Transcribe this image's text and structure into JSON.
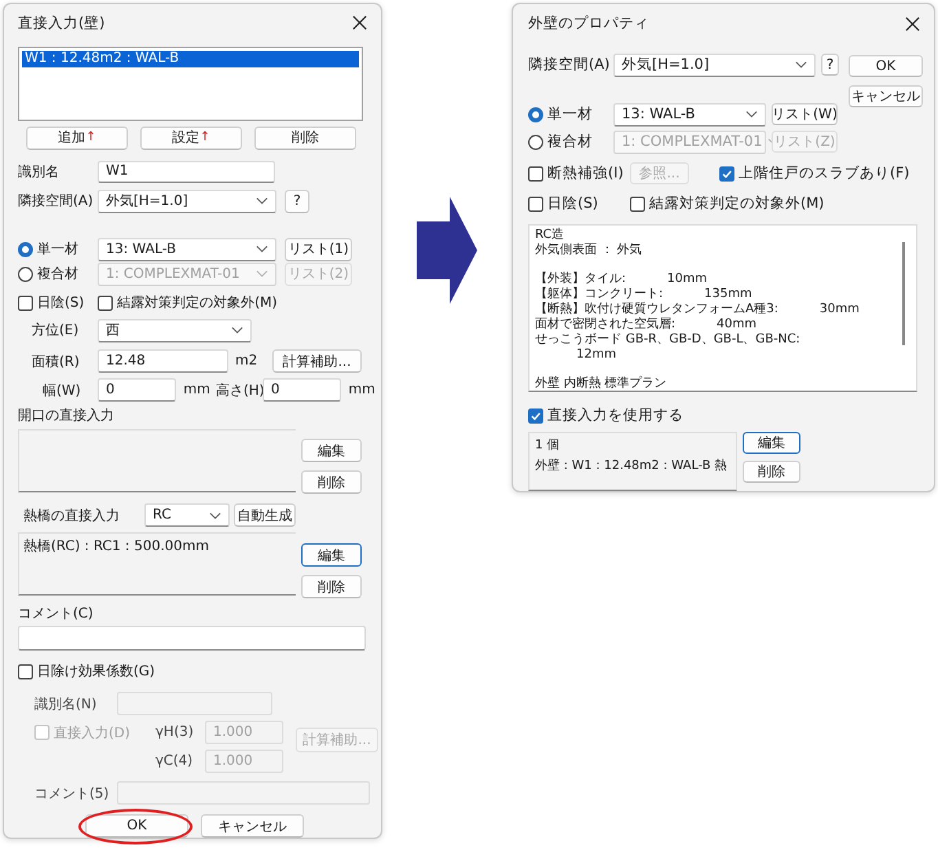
{
  "left_dialog": {
    "title": "直接入力(壁)",
    "entries": [
      {
        "text": "W1 : 12.48m2 : WAL-B",
        "selected": true
      }
    ],
    "entry_buttons": [
      {
        "label": "追加",
        "arrow": "↑"
      },
      {
        "label": "設定",
        "arrow": "↑"
      },
      {
        "label": "削除"
      }
    ],
    "name": {
      "label": "識別名",
      "value": "W1"
    },
    "adjacent": {
      "label": "隣接空間(A)",
      "value": "外気[H=1.0]",
      "help": "?"
    },
    "materials": [
      {
        "label": "単一材",
        "selected": true,
        "value": "13: WAL-B",
        "list_button": "リスト(1)",
        "disabled": false
      },
      {
        "label": "複合材",
        "selected": false,
        "value": "1: COMPLEXMAT-01",
        "list_button": "リスト(2)",
        "disabled": true
      }
    ],
    "checks": [
      {
        "label": "日陰(S)",
        "checked": false
      },
      {
        "label": "結露対策判定の対象外(M)",
        "checked": false
      }
    ],
    "direction": {
      "label": "方位(E)",
      "value": "西"
    },
    "area": {
      "label": "面積(R)",
      "value": "12.48",
      "unit": "m2",
      "button": "計算補助..."
    },
    "width": {
      "label": "幅(W)",
      "value": "0",
      "unit": "mm"
    },
    "height": {
      "label": "高さ(H)",
      "value": "0",
      "unit": "mm"
    },
    "openings": {
      "title": "開口の直接入力",
      "buttons": [
        "編集",
        "削除"
      ]
    },
    "thermal_bridge": {
      "label": "熱橋の直接入力",
      "type": "RC",
      "auto_button": "自動生成",
      "items": [
        "熱橋(RC) : RC1 : 500.00mm"
      ],
      "buttons": [
        {
          "label": "編集",
          "focused": true
        },
        {
          "label": "削除",
          "focused": false
        }
      ]
    },
    "comment": {
      "label": "コメント(C)"
    },
    "shading": {
      "label": "日除け効果係数(G)",
      "checked": false,
      "disabled": true,
      "name_label": "識別名(N)",
      "direct": {
        "label": "直接入力(D)",
        "checked": false
      },
      "gamma_h": {
        "label": "γH(3)",
        "value": "1.000"
      },
      "gamma_c": {
        "label": "γC(4)",
        "value": "1.000"
      },
      "calc_button": "計算補助...",
      "comment_label": "コメント(5)"
    },
    "ok": {
      "label": "OK",
      "circled": true
    },
    "cancel": "キャンセル"
  },
  "right_dialog": {
    "title": "外壁のプロパティ",
    "adjacent": {
      "label": "隣接空間(A)",
      "value": "外気[H=1.0]",
      "help": "?"
    },
    "ok": "OK",
    "cancel": "キャンセル",
    "materials": [
      {
        "label": "単一材",
        "selected": true,
        "value": "13: WAL-B",
        "list_button": "リスト(W)",
        "disabled": false
      },
      {
        "label": "複合材",
        "selected": false,
        "value": "1: COMPLEXMAT-01",
        "list_button": "リスト(Z)",
        "disabled": true
      }
    ],
    "insulation": {
      "label": "断熱補強(I)",
      "checked": false,
      "button": "参照...",
      "button_disabled": true
    },
    "upper_slab": {
      "label": "上階住戸のスラブあり(F)",
      "checked": true
    },
    "checks": [
      {
        "label": "日陰(S)",
        "checked": false
      },
      {
        "label": "結露対策判定の対象外(M)",
        "checked": false
      }
    ],
    "spec_paragraphs": [
      {
        "lines": [
          {
            "text": "RC造"
          },
          {
            "text": "外気側表面 ： 外気"
          }
        ]
      },
      {
        "lines": [
          {
            "text": "【外装】タイル:",
            "value": "10mm"
          },
          {
            "text": "【躯体】コンクリート:",
            "value": "135mm"
          },
          {
            "text": "【断熱】吹付け硬質ウレタンフォームA種3:",
            "value": "30mm"
          },
          {
            "text": "面材で密閉された空気層:",
            "value": "40mm"
          },
          {
            "text": "せっこうボード GB-R、GB-D、GB-L、GB-NC:",
            "value": "12mm"
          }
        ]
      },
      {
        "lines": [
          {
            "text": "外壁 内断熱 標準プラン"
          }
        ]
      }
    ],
    "direct_input": {
      "label": "直接入力を使用する",
      "checked": true,
      "lines": [
        "1 個",
        "外壁 : W1 : 12.48m2 : WAL-B 熱"
      ],
      "buttons": [
        {
          "label": "編集",
          "focused": true
        },
        {
          "label": "削除",
          "focused": false
        }
      ]
    }
  }
}
